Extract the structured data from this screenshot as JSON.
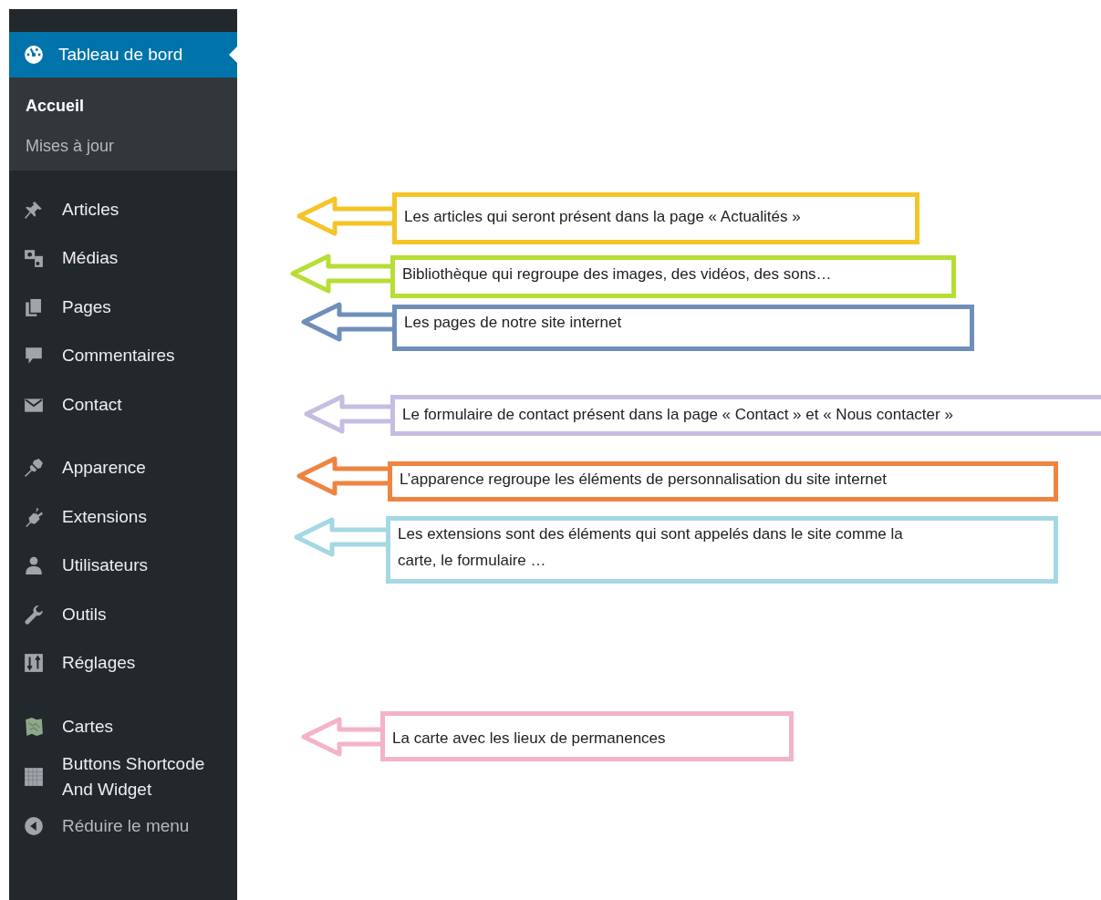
{
  "sidebar": {
    "active": {
      "label": "Tableau de bord",
      "selected": true,
      "submenu": [
        {
          "label": "Accueil",
          "selected": true
        },
        {
          "label": "Mises à jour",
          "selected": false
        }
      ]
    },
    "groups": [
      {
        "items": [
          {
            "label": "Articles",
            "selected": false
          },
          {
            "label": "Médias",
            "selected": false
          },
          {
            "label": "Pages",
            "selected": false
          },
          {
            "label": "Commentaires",
            "selected": false
          },
          {
            "label": "Contact",
            "selected": false
          }
        ]
      },
      {
        "items": [
          {
            "label": "Apparence",
            "selected": false
          },
          {
            "label": "Extensions",
            "selected": false
          },
          {
            "label": "Utilisateurs",
            "selected": false
          },
          {
            "label": "Outils",
            "selected": false
          },
          {
            "label": "Réglages",
            "selected": false
          }
        ]
      },
      {
        "items": [
          {
            "label": "Cartes",
            "selected": false
          },
          {
            "label": "Buttons Shortcode And Widget",
            "selected": false
          }
        ]
      }
    ],
    "collapse": {
      "label": "Réduire le menu"
    }
  },
  "annotations": [
    {
      "text": "Les articles qui seront présent dans la page « Actualités »",
      "color": "#f5c426"
    },
    {
      "text": "Bibliothèque qui regroupe des images, des vidéos, des sons…",
      "color": "#b6de35"
    },
    {
      "text": "Les pages de notre site internet",
      "color": "#6f8fba"
    },
    {
      "text": "Le formulaire de contact présent dans la page « Contact » et « Nous contacter »",
      "color": "#c7bde2"
    },
    {
      "text": "L’apparence regroupe les éléments de personnalisation du site internet",
      "color": "#ef8440"
    },
    {
      "text": "Les extensions sont des éléments qui sont appelés dans le site comme la carte, le formulaire …",
      "color": "#a3d8e4"
    },
    {
      "text": "La carte avec les lieux de permanences",
      "color": "#f3b3c9"
    }
  ]
}
